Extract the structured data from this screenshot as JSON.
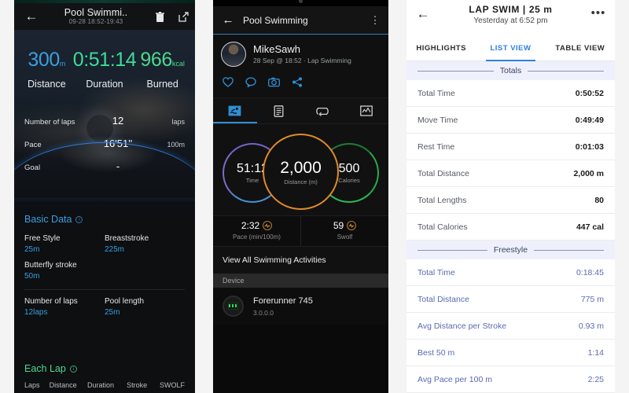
{
  "panel1": {
    "header": {
      "title": "Pool Swimmi..",
      "subtitle": "09-28 18:52-19:43",
      "back": "←",
      "delete_icon": "trash-icon",
      "share_icon": "export-icon"
    },
    "stats": [
      {
        "value": "300",
        "unit": "m",
        "label": "Distance",
        "color": "#3d9de0"
      },
      {
        "value": "0:51:14",
        "unit": "",
        "label": "Duration",
        "color": "#3ddc9a"
      },
      {
        "value": "966",
        "unit": "kcal",
        "label": "Burned",
        "color": "#4ed88e"
      }
    ],
    "rows": [
      {
        "key": "Number of laps",
        "center": "12",
        "right": "laps"
      },
      {
        "key": "Pace",
        "center": "16'51''",
        "right": "100m"
      },
      {
        "key": "Goal",
        "center": "-",
        "right": ""
      }
    ],
    "basic": {
      "title": "Basic Data",
      "info_icon": "i",
      "pairs": [
        [
          {
            "key": "Free Style",
            "value": "25m"
          },
          {
            "key": "Breaststroke",
            "value": "225m"
          }
        ],
        [
          {
            "key": "Butterfly stroke",
            "value": "50m"
          },
          {
            "key": "",
            "value": ""
          }
        ]
      ],
      "pairs2": [
        [
          {
            "key": "Number of laps",
            "value": "12laps"
          },
          {
            "key": "Pool length",
            "value": "25m"
          }
        ]
      ]
    },
    "each_lap": {
      "title": "Each Lap",
      "info_icon": "i",
      "columns": [
        "Laps",
        "Distance",
        "Duration",
        "Stroke",
        "SWOLF"
      ]
    }
  },
  "panel2": {
    "header": {
      "back": "←",
      "title": "Pool Swimming",
      "menu": "⋮"
    },
    "profile": {
      "name": "MikeSawh",
      "meta": "28 Sep @ 18:52 · Lap Swimming"
    },
    "actions": [
      "heart-icon",
      "comment-icon",
      "camera-icon",
      "share-icon"
    ],
    "tabs": [
      "activity-icon",
      "document-icon",
      "laps-icon",
      "chart-icon"
    ],
    "rings": [
      {
        "value": "51:12",
        "caption": "Time",
        "color": "#4a8fd4"
      },
      {
        "value": "2,000",
        "caption": "Distance (m)",
        "color": "#e08a2a"
      },
      {
        "value": "500",
        "caption": "Calories",
        "color": "#2dbb52"
      }
    ],
    "metrics": [
      {
        "value": "2:32",
        "caption": "Pace (min/100m)",
        "badge": "heart-rate-icon"
      },
      {
        "value": "59",
        "caption": "Swolf",
        "badge": "heart-rate-icon"
      }
    ],
    "view_all": "View All Swimming Activities",
    "device_header": "Device",
    "device": {
      "name": "Forerunner 745",
      "version": "3.0.0.0"
    }
  },
  "panel3": {
    "header": {
      "back": "←",
      "title": "LAP SWIM | 25 m",
      "subtitle": "Yesterday at 6:52 pm",
      "menu": "•••"
    },
    "tabs": [
      {
        "label": "HIGHLIGHTS",
        "active": false
      },
      {
        "label": "LIST VIEW",
        "active": true
      },
      {
        "label": "TABLE VIEW",
        "active": false
      }
    ],
    "sections": [
      {
        "title": "Totals",
        "rows": [
          {
            "key": "Total Time",
            "value": "0:50:52"
          },
          {
            "key": "Move Time",
            "value": "0:49:49"
          },
          {
            "key": "Rest Time",
            "value": "0:01:03"
          },
          {
            "key": "Total Distance",
            "value": "2,000 m"
          },
          {
            "key": "Total Lengths",
            "value": "80"
          },
          {
            "key": "Total Calories",
            "value": "447 cal"
          }
        ]
      },
      {
        "title": "Freestyle",
        "rows": [
          {
            "key": "Total Time",
            "value": "0:18:45"
          },
          {
            "key": "Total Distance",
            "value": "775 m"
          },
          {
            "key": "Avg Distance per Stroke",
            "value": "0.93 m"
          },
          {
            "key": "Best 50 m",
            "value": "1:14"
          },
          {
            "key": "Avg Pace per 100 m",
            "value": "2:25"
          }
        ]
      }
    ]
  }
}
